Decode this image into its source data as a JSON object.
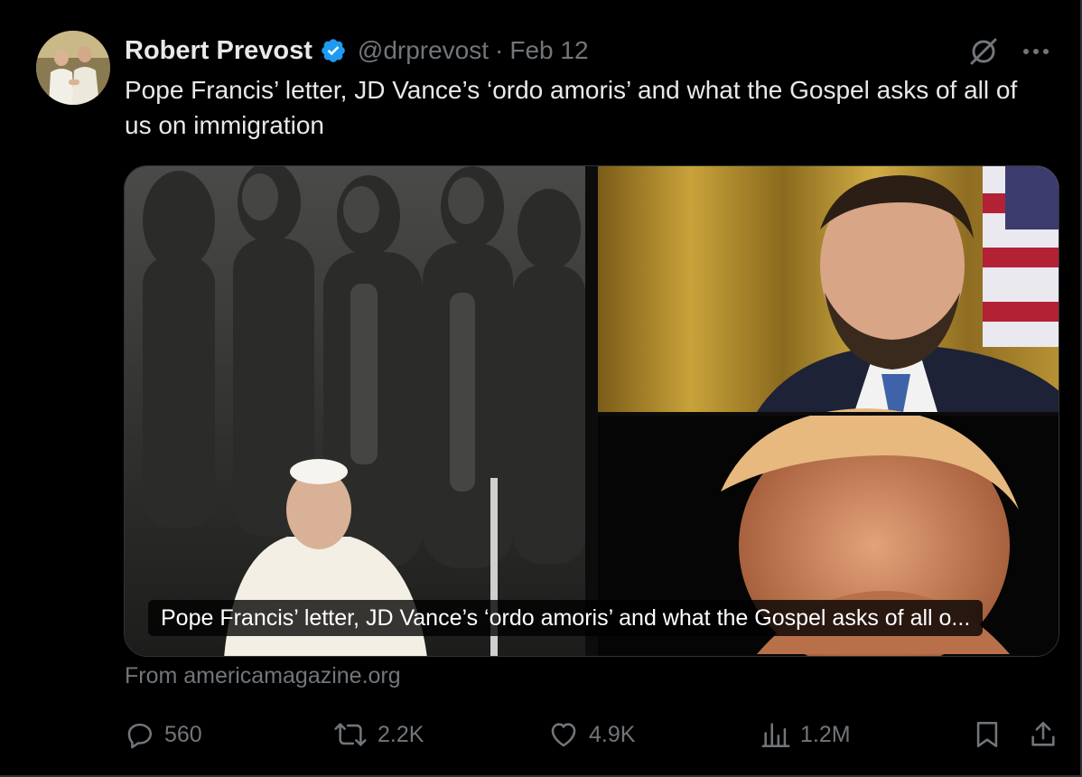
{
  "author": {
    "display_name": "Robert Prevost",
    "handle": "@drprevost",
    "separator": "·",
    "date": "Feb 12",
    "verified_icon": "verified-badge-icon"
  },
  "tweet": {
    "text": "Pope Francis’ letter, JD Vance’s ‘ordo amoris’ and what the Gospel asks of all of us on immigration"
  },
  "card": {
    "caption": "Pope Francis’ letter, JD Vance’s ‘ordo amoris’ and what the Gospel asks of all o...",
    "source": "From americamagazine.org"
  },
  "actions": {
    "replies": "560",
    "reposts": "2.2K",
    "likes": "4.9K",
    "views": "1.2M"
  },
  "colors": {
    "background": "#000000",
    "primary_text": "#e7e9ea",
    "secondary_text": "#71767b",
    "verified": "#1d9bf0",
    "border": "#2f3336"
  },
  "icons": {
    "reply": "reply-icon",
    "repost": "repost-icon",
    "like": "like-icon",
    "views": "views-icon",
    "bookmark": "bookmark-icon",
    "share": "share-icon",
    "grok": "grok-icon",
    "more": "more-icon"
  }
}
